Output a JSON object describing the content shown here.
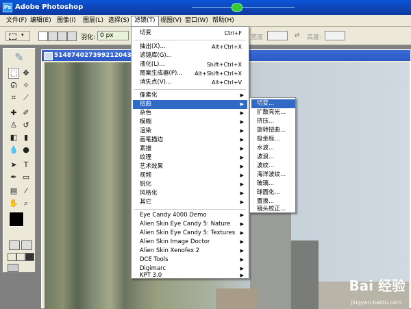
{
  "app": {
    "title": "Adobe Photoshop"
  },
  "menubar": {
    "items": [
      "文件(F)",
      "编辑(E)",
      "图像(I)",
      "图层(L)",
      "选择(S)",
      "滤镜(T)",
      "视图(V)",
      "窗口(W)",
      "帮助(H)"
    ]
  },
  "options": {
    "feather_label": "羽化:",
    "feather_value": "0 px",
    "width_label": "宽度:",
    "height_label": "高度:"
  },
  "document": {
    "title": "5148740273992120430.jp"
  },
  "filter_menu": {
    "top_items": [
      {
        "label": "切变",
        "shortcut": "Ctrl+F"
      },
      {
        "label": "抽出(X)...",
        "shortcut": "Alt+Ctrl+X"
      },
      {
        "label": "滤镜库(G)...",
        "shortcut": ""
      },
      {
        "label": "液化(L)...",
        "shortcut": "Shift+Ctrl+X"
      },
      {
        "label": "图案生成器(P)...",
        "shortcut": "Alt+Shift+Ctrl+X"
      },
      {
        "label": "消失点(V)...",
        "shortcut": "Alt+Ctrl+V"
      }
    ],
    "filters": [
      "像素化",
      "扭曲",
      "杂色",
      "模糊",
      "渲染",
      "画笔描边",
      "素描",
      "纹理",
      "艺术效果",
      "视频",
      "锐化",
      "风格化",
      "其它"
    ],
    "plugins": [
      "Eye Candy 4000  Demo",
      "Alien Skin Eye Candy 5: Nature",
      "Alien Skin Eye Candy 5: Textures",
      "Alien Skin Image Doctor",
      "Alien Skin Xenofex 2",
      "DCE Tools",
      "Digimarc",
      "KPT 3.0"
    ],
    "highlighted": "扭曲"
  },
  "distort_submenu": {
    "items": [
      "切变...",
      "扩散亮光...",
      "挤压...",
      "旋转扭曲...",
      "极坐标...",
      "水波...",
      "波浪...",
      "波纹...",
      "海洋波纹...",
      "玻璃...",
      "球面化...",
      "置换...",
      "镜头校正..."
    ],
    "highlighted": "切变..."
  },
  "watermark": {
    "text": "Bai 经验",
    "url": "jingyan.baidu.com"
  },
  "colors": {
    "highlight": "#316ac5",
    "titlebar": "#0f43b3",
    "chrome": "#ece9d8"
  }
}
